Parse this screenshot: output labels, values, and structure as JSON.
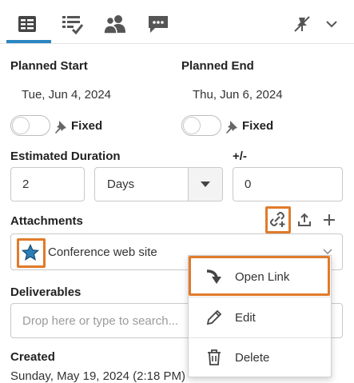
{
  "tabs": [
    {
      "name": "details",
      "icon": "form-icon",
      "active": true
    },
    {
      "name": "checklist",
      "icon": "checklist-icon",
      "active": false
    },
    {
      "name": "people",
      "icon": "people-icon",
      "active": false
    },
    {
      "name": "comments",
      "icon": "comment-icon",
      "active": false
    }
  ],
  "planned_start": {
    "label": "Planned Start",
    "value": "Tue, Jun 4, 2024",
    "fixed_label": "Fixed"
  },
  "planned_end": {
    "label": "Planned End",
    "value": "Thu, Jun 6, 2024",
    "fixed_label": "Fixed"
  },
  "estimated_duration": {
    "label": "Estimated Duration",
    "value": "2",
    "unit": "Days",
    "plusminus_label": "+/-",
    "plusminus_value": "0"
  },
  "attachments": {
    "label": "Attachments",
    "item": "Conference web site"
  },
  "deliverables": {
    "label": "Deliverables",
    "placeholder": "Drop here or type to search..."
  },
  "created": {
    "label": "Created",
    "value": "Sunday, May 19, 2024 (2:18 PM)"
  },
  "context_menu": {
    "items": [
      {
        "label": "Open Link",
        "icon": "open-link-arrow-icon"
      },
      {
        "label": "Edit",
        "icon": "pencil-icon"
      },
      {
        "label": "Delete",
        "icon": "trash-icon"
      }
    ]
  },
  "colors": {
    "accent": "#2b86c3",
    "highlight": "#e07b2a",
    "star": "#2b7fb8"
  }
}
